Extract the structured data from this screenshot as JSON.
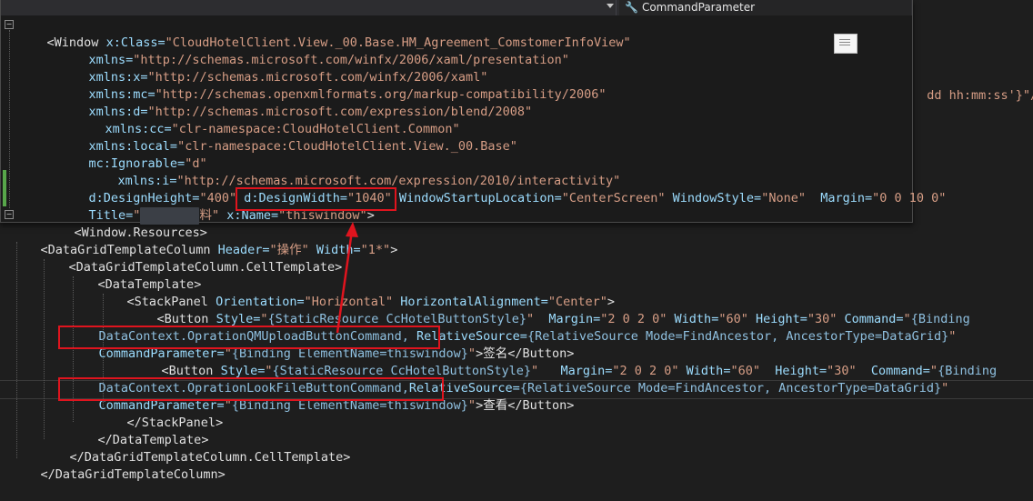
{
  "overlay": {
    "property_tab": {
      "icon": "wrench-icon",
      "label": "CommandParameter"
    },
    "lines": [
      {
        "a": "<",
        "b": "Window",
        "c": " x:Class=",
        "d": "\"CloudHotelClient.View._00.Base.HM_Agreement_ComstomerInfoView\""
      },
      {
        "a": "xmlns=",
        "b": "\"http://schemas.microsoft.com/winfx/2006/xaml/presentation\""
      },
      {
        "a": "xmlns:x=",
        "b": "\"http://schemas.microsoft.com/winfx/2006/xaml\""
      },
      {
        "a": "xmlns:mc=",
        "b": "\"http://schemas.openxmlformats.org/markup-compatibility/2006\""
      },
      {
        "a": "xmlns:d=",
        "b": "\"http://schemas.microsoft.com/expression/blend/2008\""
      },
      {
        "a": "xmlns:cc=",
        "b": "\"clr-namespace:CloudHotelClient.Common\""
      },
      {
        "a": "xmlns:local=",
        "b": "\"clr-namespace:CloudHotelClient.View._00.Base\""
      },
      {
        "a": "mc:Ignorable=",
        "b": "\"d\""
      },
      {
        "a": "xmlns:i=",
        "b": "\"http://schemas.microsoft.com/expression/2010/interactivity\""
      },
      {
        "a": "d:DesignHeight=",
        "b": "\"400\"",
        "c": " d:DesignWidth=",
        "d": "\"1040\"",
        "e": " WindowStartupLocation=",
        "f": "\"CenterScreen\"",
        "g": " WindowStyle=",
        "h": "\"None\"",
        "i": "  Margin=",
        "j": "\"0 0 10 0\""
      },
      {
        "a": "Title=",
        "b": "\"",
        "c": "料",
        "d": "\"",
        "e": "x:Name=",
        "f": "\"thiswindow\"",
        "g": ">"
      },
      {
        "a": "<",
        "b": "Window.Resources",
        "c": ">"
      }
    ],
    "right_fragment": "dd hh:mm:ss'}\"/>"
  },
  "main": {
    "lines": [
      {
        "a": "<",
        "b": "DataGridTemplateColumn",
        "c": " Header=",
        "d": "\"操作\"",
        "e": " Width=",
        "f": "\"1*\"",
        "g": ">"
      },
      {
        "a": "<",
        "b": "DataGridTemplateColumn.CellTemplate",
        "c": ">"
      },
      {
        "a": "<",
        "b": "DataTemplate",
        "c": ">"
      },
      {
        "a": "<",
        "b": "StackPanel",
        "c": " Orientation=",
        "d": "\"Horizontal\"",
        "e": " HorizontalAlignment=",
        "f": "\"Center\"",
        "g": ">"
      },
      {
        "a": "<",
        "b": "Button",
        "c": " Style=",
        "d": "\"",
        "e": "{StaticResource CcHotelButtonStyle}",
        "f": "\"",
        "g": "  Margin=",
        "h": "\"2 0 2 0\"",
        "i": " Width=",
        "j": "\"60\"",
        "k": " Height=",
        "l": "\"30\"",
        "m": " Command=",
        "n": "\"",
        "o": "{Binding"
      },
      {
        "a": "DataContext.OprationQMUploadButtonCommand,",
        "b": " RelativeSource=",
        "c": "{RelativeSource Mode=FindAncestor,",
        "d": " AncestorType=DataGrid}",
        "e": "\""
      },
      {
        "a": "CommandParameter=",
        "b": "\"",
        "c": "{Binding ElementName=thiswindow}",
        "d": "\"",
        "e": ">",
        "f": "签名",
        "g": "</",
        "h": "Button",
        "i": ">"
      },
      {
        "a": "<",
        "b": "Button",
        "c": " Style=",
        "d": "\"",
        "e": "{StaticResource CcHotelButtonStyle}",
        "f": "\"",
        "g": "   Margin=",
        "h": "\"2 0 2 0\"",
        "i": " Width=",
        "j": "\"60\"",
        "k": "  Height=",
        "l": "\"30\"",
        "m": "  Command=",
        "n": "\"",
        "o": "{Binding"
      },
      {
        "a": "DataContext.OprationLookFileButtonCommand,",
        "b": "RelativeSource=",
        "c": "{RelativeSource Mode=FindAncestor,",
        "d": " AncestorType=DataGrid}",
        "e": "\""
      },
      {
        "a": "CommandParameter=",
        "b": "\"",
        "c": "{Binding ElementName=thiswindow}",
        "d": "\"",
        "e": ">",
        "f": "查看",
        "g": "</",
        "h": "Button",
        "i": ">"
      },
      {
        "a": "</",
        "b": "StackPanel",
        "c": ">"
      },
      {
        "a": "</",
        "b": "DataTemplate",
        "c": ">"
      },
      {
        "a": "</",
        "b": "DataGridTemplateColumn.CellTemplate",
        "c": ">"
      },
      {
        "a": "</",
        "b": "DataGridTemplateColumn",
        "c": ">"
      }
    ]
  },
  "colors": {
    "annotation": "#e0141e",
    "background": "#1e1e1e"
  }
}
